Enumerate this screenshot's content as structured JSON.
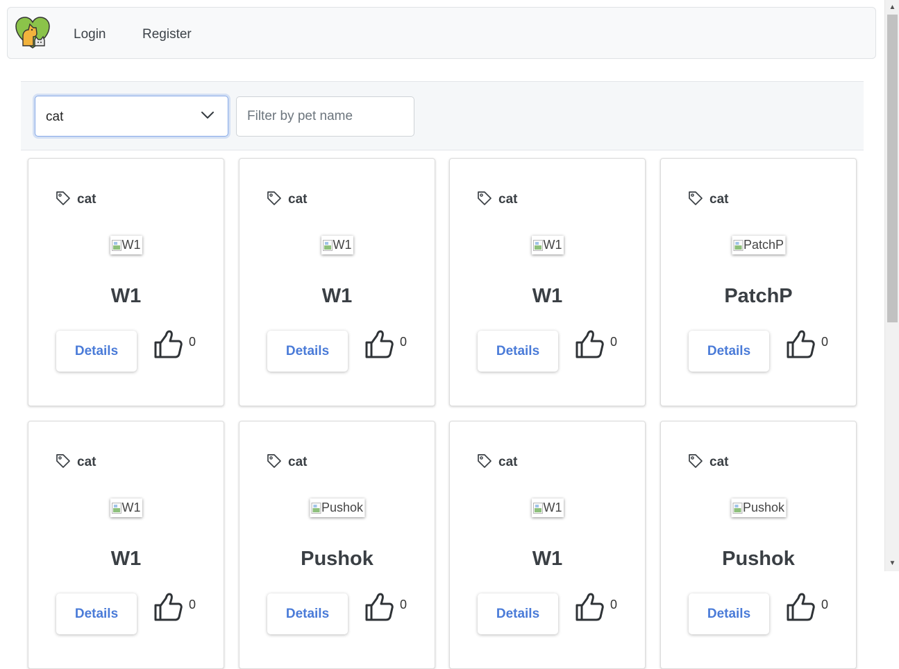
{
  "navbar": {
    "logo_icon": "pets-heart-logo-icon",
    "links": [
      {
        "label": "Login"
      },
      {
        "label": "Register"
      }
    ]
  },
  "filters": {
    "type_select": {
      "selected": "cat",
      "icon": "chevron-down-icon"
    },
    "name_filter": {
      "placeholder": "Filter by pet name",
      "value": ""
    }
  },
  "cards": [
    {
      "tag": "cat",
      "image_alt": "W1",
      "name": "W1",
      "details_label": "Details",
      "likes": "0"
    },
    {
      "tag": "cat",
      "image_alt": "W1",
      "name": "W1",
      "details_label": "Details",
      "likes": "0"
    },
    {
      "tag": "cat",
      "image_alt": "W1",
      "name": "W1",
      "details_label": "Details",
      "likes": "0"
    },
    {
      "tag": "cat",
      "image_alt": "PatchP",
      "name": "PatchP",
      "details_label": "Details",
      "likes": "0"
    },
    {
      "tag": "cat",
      "image_alt": "W1",
      "name": "W1",
      "details_label": "Details",
      "likes": "0"
    },
    {
      "tag": "cat",
      "image_alt": "Pushok",
      "name": "Pushok",
      "details_label": "Details",
      "likes": "0"
    },
    {
      "tag": "cat",
      "image_alt": "W1",
      "name": "W1",
      "details_label": "Details",
      "likes": "0"
    },
    {
      "tag": "cat",
      "image_alt": "Pushok",
      "name": "Pushok",
      "details_label": "Details",
      "likes": "0"
    }
  ],
  "icons": {
    "tag": "tag-icon",
    "like": "thumbs-up-icon"
  },
  "colors": {
    "accent": "#4a7bd8",
    "navbar_bg": "#f8f9fa",
    "filter_bg": "#f5f7f9"
  }
}
